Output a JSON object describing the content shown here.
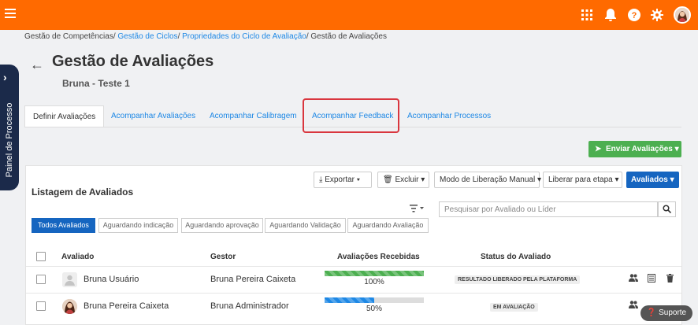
{
  "breadcrumb": {
    "item1": "Gestão de Competências",
    "item2": "Gestão de Ciclos",
    "item3": "Propriedades do Ciclo de Avaliação",
    "item4": "Gestão de Avaliações",
    "sep": "/"
  },
  "header": {
    "title": "Gestão de Avaliações",
    "subtitle": "Bruna - Teste 1"
  },
  "side_panel": {
    "label": "Painel de Processo"
  },
  "tabs": [
    {
      "label": "Definir Avaliações"
    },
    {
      "label": "Acompanhar Avaliações"
    },
    {
      "label": "Acompanhar Calibragem"
    },
    {
      "label": "Acompanhar Feedback"
    },
    {
      "label": "Acompanhar Processos"
    }
  ],
  "actions": {
    "send_label": "Enviar Avaliações"
  },
  "listing": {
    "title": "Listagem de Avaliados",
    "toolbar": {
      "export": "Exportar",
      "delete": "Excluir",
      "release_mode": "Modo de Liberação Manual",
      "release_stage": "Liberar para etapa",
      "evaluated": "Avaliados"
    },
    "search_placeholder": "Pesquisar por Avaliado ou Líder",
    "filter_tabs": [
      {
        "label": "Todos Avaliados"
      },
      {
        "label": "Aguardando indicação"
      },
      {
        "label": "Aguardando aprovação"
      },
      {
        "label": "Aguardando Validação"
      },
      {
        "label": "Aguardando Avaliação"
      }
    ],
    "columns": {
      "evaluated": "Avaliado",
      "manager": "Gestor",
      "received": "Avaliações Recebidas",
      "status": "Status do Avaliado"
    },
    "rows": [
      {
        "name": "Bruna Usuário",
        "manager": "Bruna Pereira Caixeta",
        "progress_percent": 100,
        "progress_label": "100%",
        "status": "RESULTADO LIBERADO PELA PLATAFORMA",
        "bar_color": "#4caf50"
      },
      {
        "name": "Bruna Pereira Caixeta",
        "manager": "Bruna Administrador",
        "progress_percent": 50,
        "progress_label": "50%",
        "status": "EM AVALIAÇÃO",
        "bar_color": "#1e88e5"
      }
    ]
  },
  "support": {
    "label": "Suporte"
  },
  "colors": {
    "brand": "#ff6a00",
    "primary": "#1565c0",
    "success": "#4caf50",
    "highlight": "#d9363e"
  }
}
